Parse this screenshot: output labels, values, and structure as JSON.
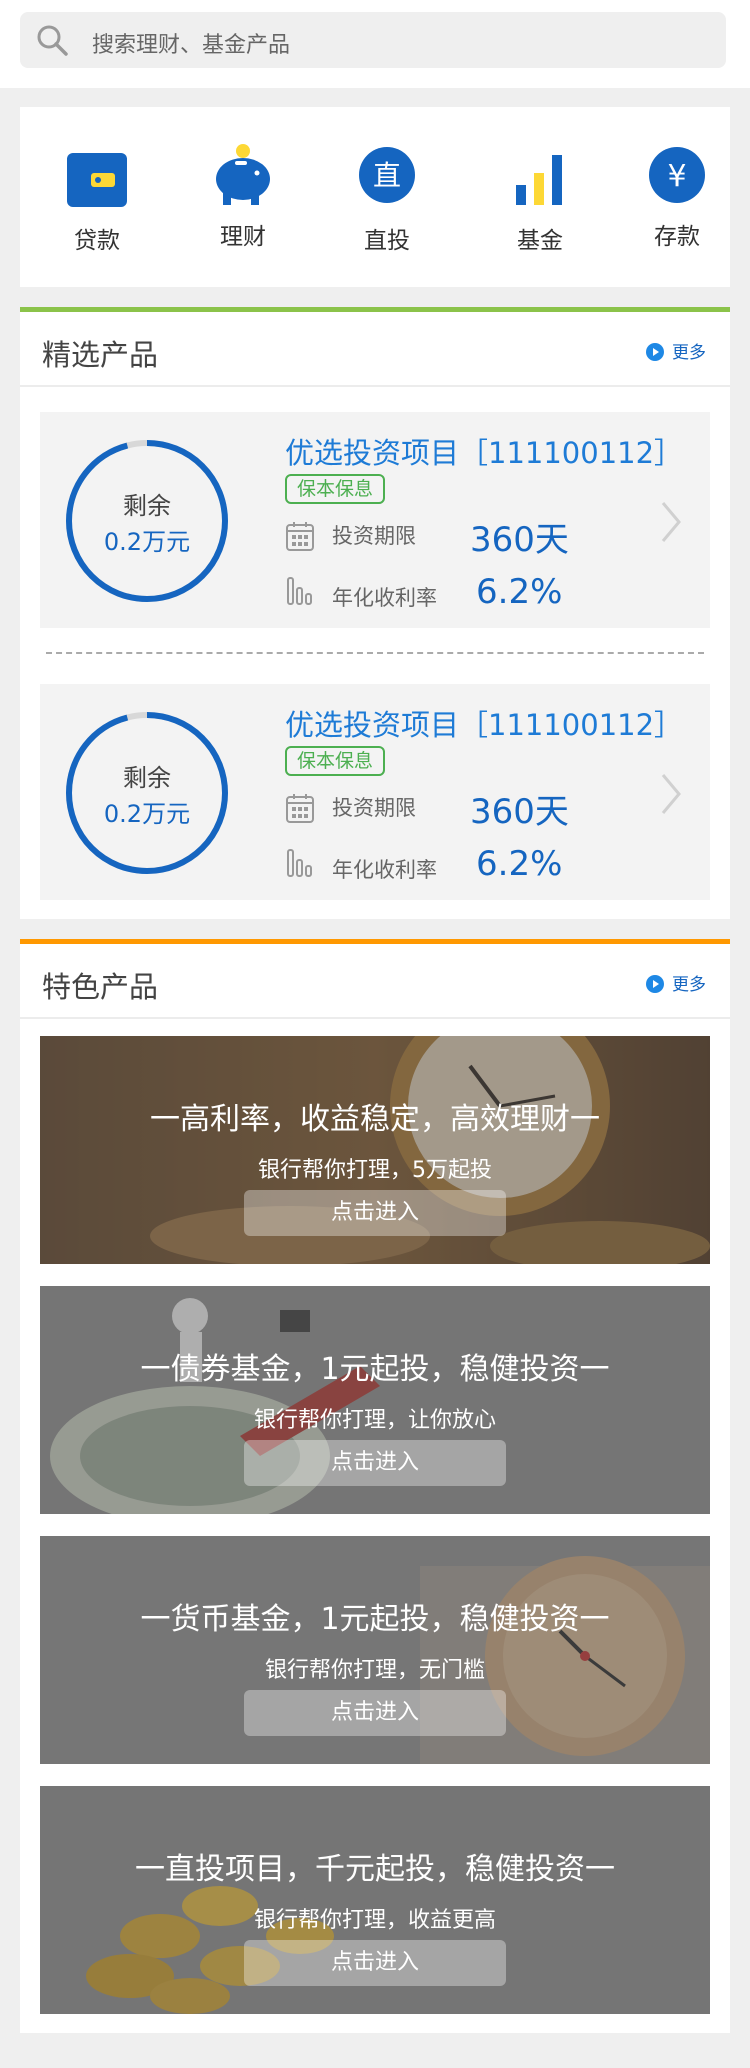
{
  "search": {
    "placeholder": "搜索理财、基金产品"
  },
  "categories": [
    {
      "label": "贷款",
      "icon": "wallet-icon"
    },
    {
      "label": "理财",
      "icon": "piggy-bank-icon"
    },
    {
      "label": "直投",
      "icon": "direct-invest-icon"
    },
    {
      "label": "基金",
      "icon": "bar-chart-icon"
    },
    {
      "label": "存款",
      "icon": "yen-icon"
    }
  ],
  "featured": {
    "title": "精选产品",
    "more": "更多",
    "accent": "#8bc34a",
    "products": [
      {
        "remaining_label": "剩余",
        "remaining_value": "0.2万元",
        "name": "优选投资项目［111100112］",
        "badge": "保本保息",
        "term_label": "投资期限",
        "term_value": "360天",
        "rate_label": "年化收利率",
        "rate_value": "6.2%"
      },
      {
        "remaining_label": "剩余",
        "remaining_value": "0.2万元",
        "name": "优选投资项目［111100112］",
        "badge": "保本保息",
        "term_label": "投资期限",
        "term_value": "360天",
        "rate_label": "年化收利率",
        "rate_value": "6.2%"
      }
    ]
  },
  "special": {
    "title": "特色产品",
    "more": "更多",
    "accent": "#ff9800",
    "banners": [
      {
        "title": "一高利率，收益稳定，高效理财一",
        "subtitle": "银行帮你打理，5万起投",
        "button": "点击进入"
      },
      {
        "title": "一债券基金，1元起投，稳健投资一",
        "subtitle": "银行帮你打理，让你放心",
        "button": "点击进入"
      },
      {
        "title": "一货币基金，1元起投，稳健投资一",
        "subtitle": "银行帮你打理，无门槛",
        "button": "点击进入"
      },
      {
        "title": "一直投项目，千元起投，稳健投资一",
        "subtitle": "银行帮你打理，收益更高",
        "button": "点击进入"
      }
    ]
  },
  "colors": {
    "primary": "#1565c0",
    "green": "#4caf50"
  }
}
